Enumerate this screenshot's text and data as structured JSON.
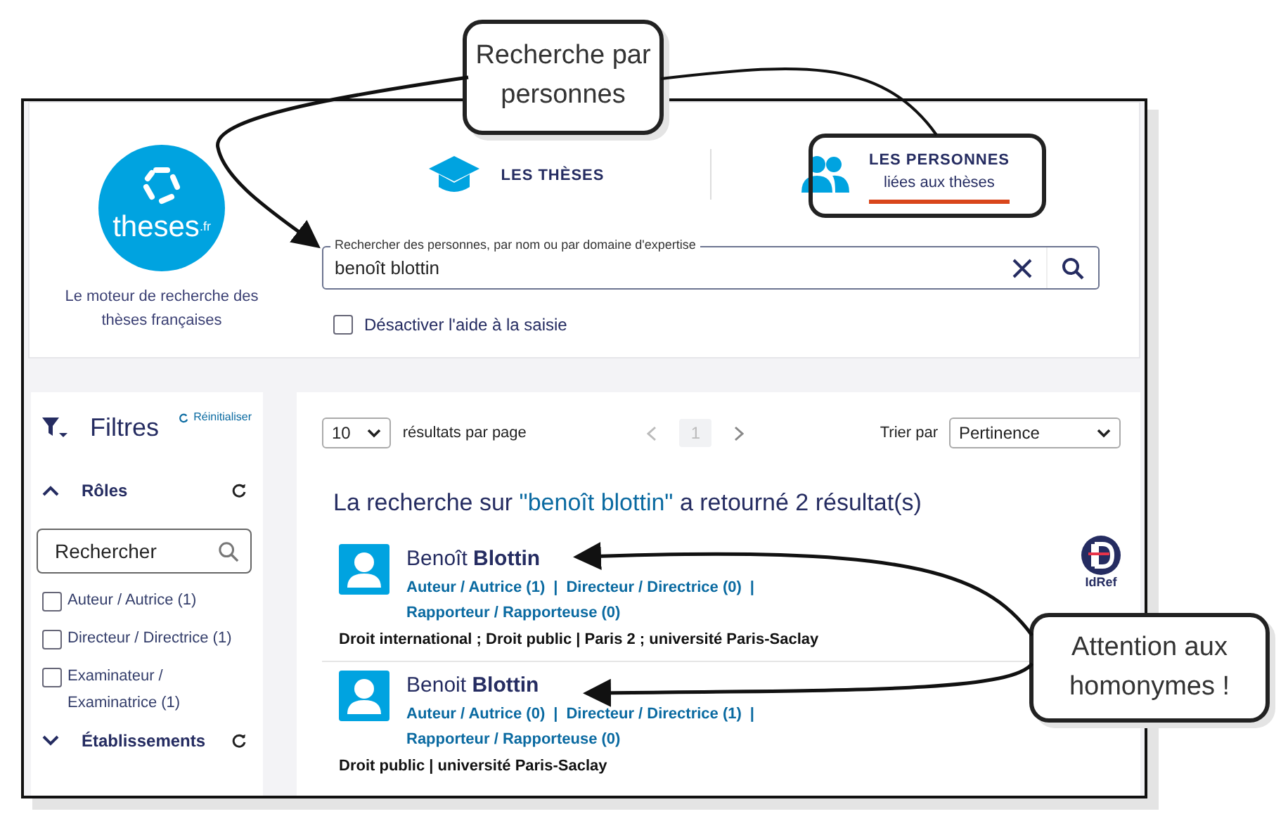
{
  "annotations": {
    "top_callout": "Recherche par personnes",
    "side_callout": "Attention aux homonymes !",
    "highlight": true
  },
  "header": {
    "logo": "theses$^{.fr}$",
    "tagline": "Le moteur de recherche des thèses françaises",
    "tabs": [
      {
        "kind": "theses",
        "label": "LES THÈSES",
        "selected": false
      },
      {
        "kind": "people",
        "label": "LES PERSONNES",
        "sublabel": "liées aux thèses",
        "selected": true
      }
    ],
    "search": {
      "label": "Rechercher des personnes, par nom ou par domaine d'expertise",
      "value": "benoît blottin"
    },
    "assist": {
      "label": "Désactiver l'aide à la saisie",
      "checked": false
    }
  },
  "sidebar": {
    "title": "Filtres",
    "reset": "Réinitialiser",
    "sections": [
      {
        "title": "Rôles",
        "expanded": true,
        "placeholder": "Rechercher",
        "options": [
          {
            "label": "Auteur / Autrice (1)",
            "checked": false
          },
          {
            "label": "Directeur / Directrice (1)",
            "checked": false
          },
          {
            "label": "Examinateur / Examinatrice (1)",
            "checked": false
          }
        ]
      },
      {
        "title": "Établissements",
        "expanded": false
      }
    ]
  },
  "toolbar": {
    "per_page": "10",
    "per_page_label": "résultats par page",
    "page": "1",
    "sort_label": "Trier par",
    "sort": "Pertinence"
  },
  "summary": {
    "prefix": "La recherche sur",
    "query": "\"benoît blottin\"",
    "suffix": "a retourné 2 résultat(s)"
  },
  "results": [
    {
      "name": "Benoît **Blottin**",
      "roles": [
        "Auteur / Autrice (1)",
        "Directeur / Directrice (0)",
        "Rapporteur / Rapporteuse (0)"
      ],
      "separator": "|",
      "details": "Droit international ; Droit public | Paris 2 ; université Paris-Saclay",
      "idref": "IdRef"
    },
    {
      "name": "Benoit **Blottin**",
      "roles": [
        "Auteur / Autrice (0)",
        "Directeur / Directrice (1)",
        "Rapporteur / Rapporteuse (0)"
      ],
      "separator": "|",
      "details": "Droit public | université Paris-Saclay"
    }
  ]
}
